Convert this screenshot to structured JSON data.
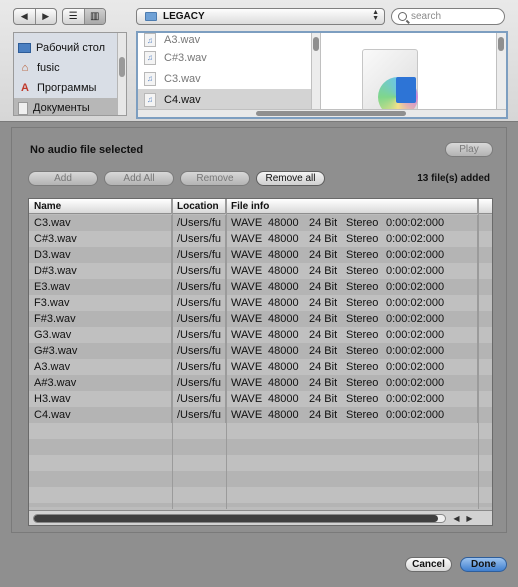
{
  "toolbar": {
    "back_icon": "back-arrow-icon",
    "forward_icon": "forward-arrow-icon",
    "list_view_icon": "list-view-icon",
    "column_view_icon": "column-view-icon",
    "path": "LEGACY",
    "search_placeholder": "search"
  },
  "sidebar": {
    "items": [
      {
        "label": "Рабочий стол",
        "icon": "desktop-icon"
      },
      {
        "label": "fusic",
        "icon": "home-icon"
      },
      {
        "label": "Программы",
        "icon": "applications-icon"
      },
      {
        "label": "Документы",
        "icon": "documents-icon"
      }
    ]
  },
  "browser": {
    "files": [
      "A3.wav",
      "C#3.wav",
      "C3.wav",
      "C4.wav"
    ],
    "selected": "C4.wav"
  },
  "panel": {
    "status": "No audio file selected",
    "play_label": "Play",
    "add_label": "Add",
    "add_all_label": "Add All",
    "remove_label": "Remove",
    "remove_all_label": "Remove all",
    "files_added": "13 file(s) added"
  },
  "table": {
    "headers": {
      "name": "Name",
      "location": "Location",
      "info": "File info"
    },
    "rows": [
      {
        "name": "C3.wav",
        "location": "/Users/fu",
        "format": "WAVE",
        "rate": "48000",
        "bits": "24 Bit",
        "channels": "Stereo",
        "duration": "0:00:02:000"
      },
      {
        "name": "C#3.wav",
        "location": "/Users/fu",
        "format": "WAVE",
        "rate": "48000",
        "bits": "24 Bit",
        "channels": "Stereo",
        "duration": "0:00:02:000"
      },
      {
        "name": "D3.wav",
        "location": "/Users/fu",
        "format": "WAVE",
        "rate": "48000",
        "bits": "24 Bit",
        "channels": "Stereo",
        "duration": "0:00:02:000"
      },
      {
        "name": "D#3.wav",
        "location": "/Users/fu",
        "format": "WAVE",
        "rate": "48000",
        "bits": "24 Bit",
        "channels": "Stereo",
        "duration": "0:00:02:000"
      },
      {
        "name": "E3.wav",
        "location": "/Users/fu",
        "format": "WAVE",
        "rate": "48000",
        "bits": "24 Bit",
        "channels": "Stereo",
        "duration": "0:00:02:000"
      },
      {
        "name": "F3.wav",
        "location": "/Users/fu",
        "format": "WAVE",
        "rate": "48000",
        "bits": "24 Bit",
        "channels": "Stereo",
        "duration": "0:00:02:000"
      },
      {
        "name": "F#3.wav",
        "location": "/Users/fu",
        "format": "WAVE",
        "rate": "48000",
        "bits": "24 Bit",
        "channels": "Stereo",
        "duration": "0:00:02:000"
      },
      {
        "name": "G3.wav",
        "location": "/Users/fu",
        "format": "WAVE",
        "rate": "48000",
        "bits": "24 Bit",
        "channels": "Stereo",
        "duration": "0:00:02:000"
      },
      {
        "name": "G#3.wav",
        "location": "/Users/fu",
        "format": "WAVE",
        "rate": "48000",
        "bits": "24 Bit",
        "channels": "Stereo",
        "duration": "0:00:02:000"
      },
      {
        "name": "A3.wav",
        "location": "/Users/fu",
        "format": "WAVE",
        "rate": "48000",
        "bits": "24 Bit",
        "channels": "Stereo",
        "duration": "0:00:02:000"
      },
      {
        "name": "A#3.wav",
        "location": "/Users/fu",
        "format": "WAVE",
        "rate": "48000",
        "bits": "24 Bit",
        "channels": "Stereo",
        "duration": "0:00:02:000"
      },
      {
        "name": "H3.wav",
        "location": "/Users/fu",
        "format": "WAVE",
        "rate": "48000",
        "bits": "24 Bit",
        "channels": "Stereo",
        "duration": "0:00:02:000"
      },
      {
        "name": "C4.wav",
        "location": "/Users/fu",
        "format": "WAVE",
        "rate": "48000",
        "bits": "24 Bit",
        "channels": "Stereo",
        "duration": "0:00:02:000"
      }
    ]
  },
  "footer": {
    "cancel_label": "Cancel",
    "done_label": "Done"
  },
  "colors": {
    "accent": "#3f7fcf",
    "panel_bg": "#8f8f8f",
    "selection": "#d3d3d3"
  }
}
